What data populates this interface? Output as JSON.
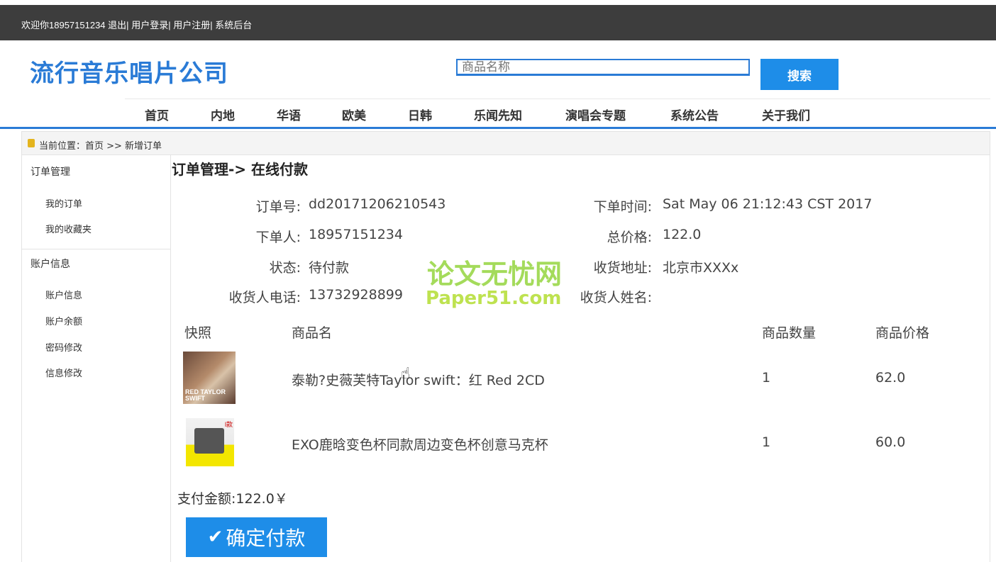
{
  "topbar": {
    "welcome": "欢迎你18957151234",
    "logout": "退出",
    "sep1": "|",
    "login": "用户登录",
    "sep2": "|",
    "register": "用户注册",
    "sep3": "|",
    "admin": "系统后台"
  },
  "header": {
    "logo": "流行音乐唱片公司",
    "search_placeholder": "商品名称",
    "search_button": "搜索"
  },
  "nav": [
    "首页",
    "内地",
    "华语",
    "欧美",
    "日韩",
    "乐闻先知",
    "演唱会专题",
    "系统公告",
    "关于我们"
  ],
  "breadcrumb": "当前位置：首页 >> 新增订单",
  "sidebar": {
    "group1": "订单管理",
    "group1_items": [
      "我的订单",
      "我的收藏夹"
    ],
    "group2": "账户信息",
    "group2_items": [
      "账户信息",
      "账户余额",
      "密码修改",
      "信息修改"
    ]
  },
  "main": {
    "title": "订单管理-> 在线付款",
    "order_no_label": "订单号:",
    "order_no": "dd20171206210543",
    "order_time_label": "下单时间:",
    "order_time": "Sat May 06 21:12:43 CST 2017",
    "orderer_label": "下单人:",
    "orderer": "18957151234",
    "total_label": "总价格:",
    "total": "122.0",
    "status_label": "状态:",
    "status": "待付款",
    "address_label": "收货地址:",
    "address": "北京市XXXx",
    "phone_label": "收货人电话:",
    "phone": "13732928899",
    "receiver_label": "收货人姓名:",
    "receiver": ""
  },
  "table": {
    "headers": [
      "快照",
      "商品名",
      "商品数量",
      "商品价格"
    ],
    "rows": [
      {
        "name": "泰勒?史薇芙特Taylor swift：红 Red 2CD",
        "qty": "1",
        "price": "62.0",
        "thumb_text": "RED TAYLOR SWIFT"
      },
      {
        "name": "EXO鹿晗变色杯同款周边变色杯创意马克杯",
        "qty": "1",
        "price": "60.0",
        "thumb_text": "l款"
      }
    ]
  },
  "pay": {
    "amount": "支付金额:122.0￥",
    "button": "确定付款"
  },
  "watermark": {
    "cn": "论文无忧网",
    "en": "Paper51.com"
  }
}
